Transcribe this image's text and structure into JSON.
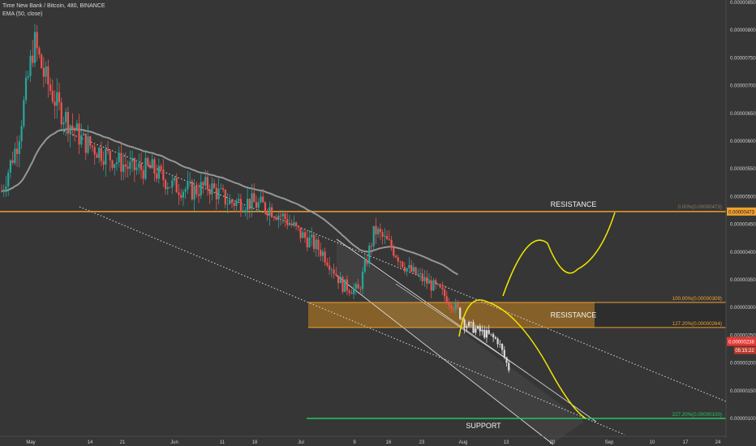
{
  "header": {
    "symbol_line": "Time New Bank / Bitcoin, 480, BINANCE",
    "indicator_line": "EMA (50, close)"
  },
  "chart_data": {
    "type": "candlestick",
    "y_axis_ticks": [
      "0.00000850",
      "0.00000800",
      "0.00000750",
      "0.00000700",
      "0.00000650",
      "0.00000600",
      "0.00000550",
      "0.00000500",
      "0.00000450",
      "0.00000400",
      "0.00000350",
      "0.00000300",
      "0.00000250",
      "0.00000200",
      "0.00000150",
      "0.00000100"
    ],
    "x_axis_ticks": [
      "May",
      "14",
      "21",
      "Jun",
      "11",
      "18",
      "Jul",
      "9",
      "16",
      "23",
      "Aug",
      "13",
      "20",
      "Sep",
      "10",
      "17",
      "24"
    ],
    "ylim": [
      9.5e-07,
      8.5e-06
    ],
    "close_series": [
      5.1e-06,
      6e-06,
      7.8e-06,
      7.2e-06,
      6.6e-06,
      6e-06,
      5.7e-06,
      5.5e-06,
      5.5e-06,
      5.2e-06,
      5.1e-06,
      5.2e-06,
      4.9e-06,
      4.9e-06,
      4.8e-06,
      4.6e-06,
      4.3e-06,
      4.2e-06,
      4.1e-06,
      4e-06,
      3.8e-06,
      3.4e-06,
      3.3e-06,
      4.4e-06,
      4.1e-06,
      3.7e-06,
      3.5e-06,
      3.3e-06,
      3e-06,
      2.7e-06,
      2.6e-06,
      2.5e-06,
      2.4e-06,
      1.9e-06,
      1.8e-06,
      1.7e-06,
      1.5e-06,
      1e-06
    ],
    "current_price": "0.00000238",
    "countdown": "05:15:22",
    "levels": [
      {
        "label": "0.00%(0.00000473)",
        "price": "0.00000473",
        "color": "#f0a030",
        "text": "RESISTANCE"
      },
      {
        "label": "100.00%(0.00000309)",
        "color": "#f0a030"
      },
      {
        "label": "127.20%(0.00000264)",
        "color": "#f0a030"
      },
      {
        "label": "227.20%(0.00000100)",
        "color": "#22c55e"
      }
    ],
    "zone_text": "RESISTANCE",
    "support_text": "SUPPORT",
    "colors": {
      "up": "#26a69a",
      "down": "#ef5350",
      "ema": "#a8a8a8",
      "level": "#f0a030",
      "support": "#22c55e",
      "projection": "#f2e600",
      "price_badge": "#e53935"
    }
  }
}
